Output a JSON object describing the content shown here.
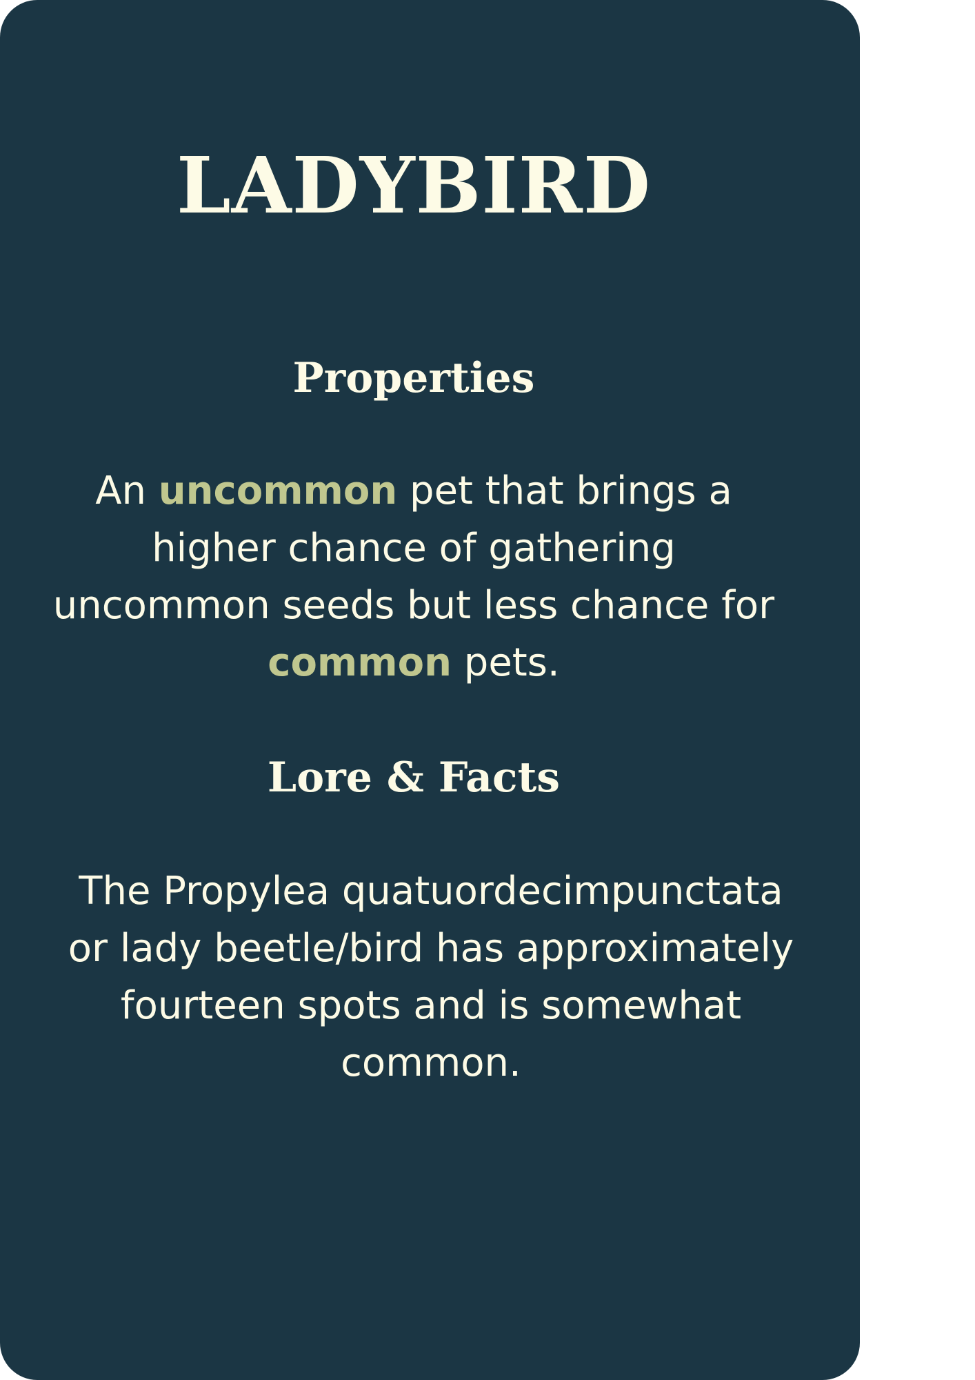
{
  "colors": {
    "card_background": "#1b3644",
    "text": "#fdfbe6",
    "highlight": "#c0c78f"
  },
  "card": {
    "title": "LADYBIRD",
    "properties": {
      "heading": "Properties",
      "text_part1": "An ",
      "highlight1": "uncommon",
      "text_part2": " pet that brings a higher chance of gathering uncommon seeds but less chance for ",
      "highlight2": "common",
      "text_part3": " pets."
    },
    "lore": {
      "heading": "Lore & Facts",
      "text": "The Propylea quatuordecimpunctata or lady beetle/bird has approximately fourteen spots and is somewhat common."
    }
  }
}
